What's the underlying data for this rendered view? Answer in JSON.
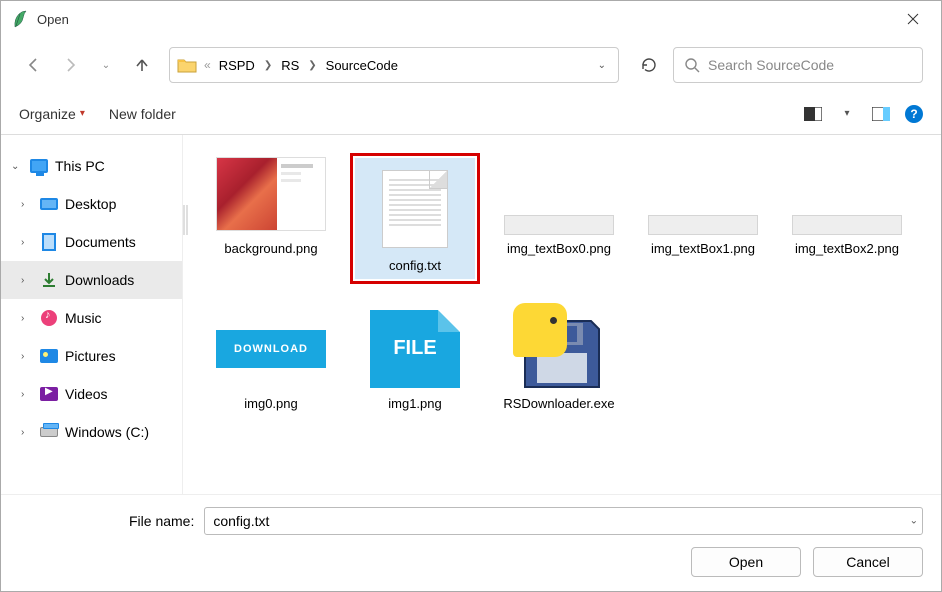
{
  "window": {
    "title": "Open"
  },
  "breadcrumbs": {
    "prefix": "«",
    "items": [
      "RSPD",
      "RS",
      "SourceCode"
    ]
  },
  "search": {
    "placeholder": "Search SourceCode"
  },
  "toolbar": {
    "organize": "Organize",
    "newfolder": "New folder",
    "help": "?"
  },
  "sidebar": {
    "root": "This PC",
    "items": [
      {
        "label": "Desktop",
        "icon": "desktop"
      },
      {
        "label": "Documents",
        "icon": "doc"
      },
      {
        "label": "Downloads",
        "icon": "dl",
        "selected": true
      },
      {
        "label": "Music",
        "icon": "music"
      },
      {
        "label": "Pictures",
        "icon": "pic"
      },
      {
        "label": "Videos",
        "icon": "vid"
      },
      {
        "label": "Windows (C:)",
        "icon": "drive"
      }
    ]
  },
  "files": [
    {
      "name": "background.png",
      "thumb": "bg"
    },
    {
      "name": "config.txt",
      "thumb": "doc",
      "selected": true
    },
    {
      "name": "img_textBox0.png",
      "thumb": "empty"
    },
    {
      "name": "img_textBox1.png",
      "thumb": "empty"
    },
    {
      "name": "img_textBox2.png",
      "thumb": "empty"
    },
    {
      "name": "img0.png",
      "thumb": "dl",
      "dl_label": "DOWNLOAD"
    },
    {
      "name": "img1.png",
      "thumb": "file",
      "file_label": "FILE"
    },
    {
      "name": "RSDownloader.exe",
      "thumb": "pyexe"
    }
  ],
  "footer": {
    "filename_label": "File name:",
    "filename_value": "config.txt",
    "open": "Open",
    "cancel": "Cancel"
  }
}
